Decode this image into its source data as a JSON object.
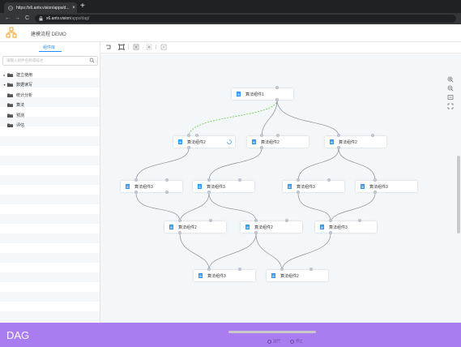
{
  "browser": {
    "tab_title": "https://x6.antv.vision/apps/d...",
    "tab_close": "×",
    "new_tab": "+",
    "back": "←",
    "forward": "→",
    "reload": "C",
    "url_host": "x6.antv.vision",
    "url_path": "/apps/dag/"
  },
  "app": {
    "title": "建模流程 DEMO"
  },
  "left_panel": {
    "tab_label": "组件库",
    "search_placeholder": "请输入组件名称或描述",
    "tree": [
      {
        "label": "建立使用",
        "level": 0,
        "caret": "▸"
      },
      {
        "label": "数据读写",
        "level": 0,
        "caret": "▾"
      },
      {
        "label": "统计分析",
        "level": 1
      },
      {
        "label": "算法",
        "level": 1
      },
      {
        "label": "预测",
        "level": 1
      },
      {
        "label": "评估",
        "level": 1
      }
    ]
  },
  "nodes": {
    "n1": "算法组件1",
    "n2a": "算法组件2",
    "n2b": "算法组件2",
    "n2c": "算法组件2",
    "n3a": "算法组件3",
    "n3b": "算法组件3",
    "n3c": "算法组件3",
    "n3d": "算法组件3",
    "n4a": "算法组件2",
    "n4b": "算法组件2",
    "n4c": "算法组件3",
    "n5a": "算法组件3",
    "n5b": "算法组件2"
  },
  "colors": {
    "accent": "#1890ff",
    "edge": "#8a8f96",
    "running_edge": "#52c41a",
    "bottom_band": "#a97cf0"
  },
  "footer": {
    "caption": "DAG",
    "status_left": "运行",
    "status_right": "停止"
  }
}
